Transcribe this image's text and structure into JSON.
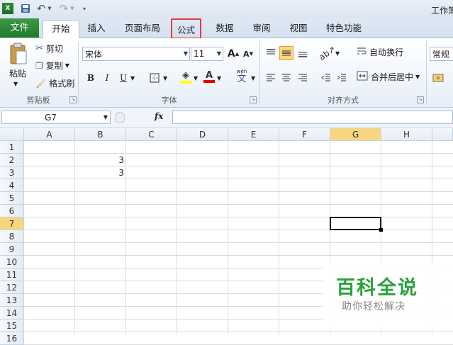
{
  "window": {
    "title": "工作簿"
  },
  "qat": {
    "undo_label": "↶",
    "redo_label": "↷"
  },
  "tabs": [
    {
      "label": "文件"
    },
    {
      "label": "开始"
    },
    {
      "label": "插入"
    },
    {
      "label": "页面布局"
    },
    {
      "label": "公式"
    },
    {
      "label": "数据"
    },
    {
      "label": "审阅"
    },
    {
      "label": "视图"
    },
    {
      "label": "特色功能"
    }
  ],
  "clipboard": {
    "paste": "粘贴",
    "cut": "剪切",
    "copy": "复制",
    "format_painter": "格式刷",
    "group_label": "剪贴板"
  },
  "font": {
    "name": "宋体",
    "size": "11",
    "group_label": "字体",
    "bold": "B",
    "italic": "I",
    "underline": "U",
    "wen": "wén",
    "grow": "A",
    "shrink": "A"
  },
  "alignment": {
    "wrap_text": "自动换行",
    "merge_center": "合并后居中",
    "group_label": "对齐方式"
  },
  "number": {
    "format": "常规"
  },
  "formula_bar": {
    "name_box": "G7",
    "fx": "fx",
    "content": ""
  },
  "grid": {
    "columns": [
      "A",
      "B",
      "C",
      "D",
      "E",
      "F",
      "G",
      "H"
    ],
    "rows": [
      "1",
      "2",
      "3",
      "4",
      "5",
      "6",
      "7",
      "8",
      "9",
      "10",
      "11",
      "12",
      "13",
      "14",
      "15",
      "16"
    ],
    "active_column": "G",
    "active_row": "7",
    "cells": [
      {
        "ref": "B2",
        "value": "3"
      },
      {
        "ref": "B3",
        "value": "3"
      }
    ]
  },
  "watermark": {
    "title": "百科全说",
    "subtitle": "助你轻松解决"
  }
}
